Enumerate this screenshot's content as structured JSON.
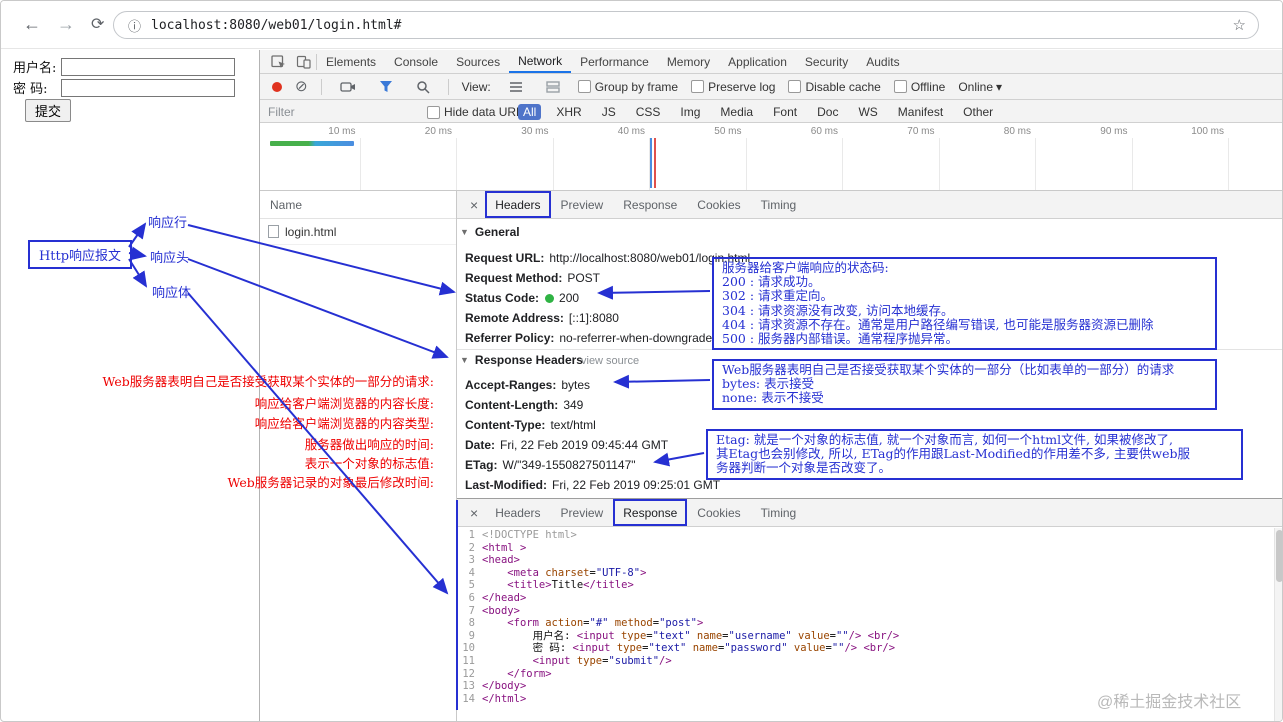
{
  "browser": {
    "url": "localhost:8080/web01/login.html#"
  },
  "icons": {
    "back": "←",
    "forward": "→",
    "refresh": "⟳",
    "info": "ⓘ",
    "star": "☆",
    "close": "×",
    "caret_down": "▾",
    "triangle_down": "▼",
    "record": "●",
    "clear": "⊘"
  },
  "login_form": {
    "username_label": "用户名:",
    "username_value": "",
    "password_label": "密 码:",
    "password_value": "",
    "submit_label": "提交"
  },
  "devtools": {
    "tabs": [
      "Elements",
      "Console",
      "Sources",
      "Network",
      "Performance",
      "Memory",
      "Application",
      "Security",
      "Audits"
    ],
    "selected_tab": "Network",
    "toolbar": {
      "view_label": "View:",
      "checkboxes": [
        "Group by frame",
        "Preserve log",
        "Disable cache",
        "Offline"
      ],
      "online_label": "Online"
    },
    "filter_bar": {
      "placeholder": "Filter",
      "hide_data_urls": "Hide data URLs",
      "types": [
        "All",
        "XHR",
        "JS",
        "CSS",
        "Img",
        "Media",
        "Font",
        "Doc",
        "WS",
        "Manifest",
        "Other"
      ],
      "selected_type": "All"
    },
    "timeline": {
      "ticks": [
        "10 ms",
        "20 ms",
        "30 ms",
        "40 ms",
        "50 ms",
        "60 ms",
        "70 ms",
        "80 ms",
        "90 ms",
        "100 ms"
      ]
    },
    "request_list": {
      "name_header": "Name",
      "rows": [
        "login.html"
      ]
    },
    "panel1": {
      "tabs": [
        "Headers",
        "Preview",
        "Response",
        "Cookies",
        "Timing"
      ],
      "selected": "Headers",
      "general": {
        "title": "General",
        "fields": [
          {
            "name": "Request URL:",
            "value": "http://localhost:8080/web01/login.html"
          },
          {
            "name": "Request Method:",
            "value": "POST"
          },
          {
            "name": "Status Code:",
            "value": "200",
            "status_dot": true
          },
          {
            "name": "Remote Address:",
            "value": "[::1]:8080"
          },
          {
            "name": "Referrer Policy:",
            "value": "no-referrer-when-downgrade"
          }
        ]
      },
      "response_headers": {
        "title": "Response Headers",
        "view_source_label": "view source",
        "fields": [
          {
            "name": "Accept-Ranges:",
            "value": "bytes"
          },
          {
            "name": "Content-Length:",
            "value": "349"
          },
          {
            "name": "Content-Type:",
            "value": "text/html"
          },
          {
            "name": "Date:",
            "value": "Fri, 22 Feb 2019 09:45:44 GMT"
          },
          {
            "name": "ETag:",
            "value": "W/\"349-1550827501147\""
          },
          {
            "name": "Last-Modified:",
            "value": "Fri, 22 Feb 2019 09:25:01 GMT"
          }
        ]
      }
    },
    "panel2": {
      "tabs": [
        "Headers",
        "Preview",
        "Response",
        "Cookies",
        "Timing"
      ],
      "selected": "Response",
      "code_lines": [
        "<!DOCTYPE html>",
        "<html >",
        "<head>",
        "    <meta charset=\"UTF-8\">",
        "    <title>Title</title>",
        "</head>",
        "<body>",
        "    <form action=\"#\" method=\"post\">",
        "        用户名: <input type=\"text\" name=\"username\" value=\"\"/> <br/>",
        "        密 码: <input type=\"text\" name=\"password\" value=\"\"/> <br/>",
        "        <input type=\"submit\"/>",
        "    </form>",
        "</body>",
        "</html>"
      ]
    }
  },
  "annotations": {
    "accent_color": "#2630d2",
    "http_box_label": "Http响应报文",
    "pointer_labels": [
      "响应行",
      "响应头",
      "响应体"
    ],
    "panel1_ringed_tab": "Headers",
    "panel2_ringed_tab": "Response",
    "red_notes": [
      "Web服务器表明自己是否接受获取某个实体的一部分的请求:",
      "响应给客户端浏览器的内容长度:",
      "响应给客户端浏览器的内容类型:",
      "服务器做出响应的时间:",
      "表示一个对象的标志值:",
      "Web服务器记录的对象最后修改时间:"
    ],
    "status_code_box_lines": [
      "服务器给客户端响应的状态码:",
      "200 : 请求成功。",
      "302 : 请求重定向。",
      "304 : 请求资源没有改变, 访问本地缓存。",
      "404 : 请求资源不存在。通常是用户路径编写错误, 也可能是服务器资源已删除",
      "500 : 服务器内部错误。通常程序抛异常。"
    ],
    "accept_ranges_box_lines": [
      "Web服务器表明自己是否接受获取某个实体的一部分（比如表单的一部分）的请求",
      "bytes: 表示接受",
      "none: 表示不接受"
    ],
    "etag_box_lines": [
      "Etag: 就是一个对象的标志值, 就一个对象而言, 如何一个html文件, 如果被修改了,",
      "其Etag也会别修改, 所以, ETag的作用跟Last-Modified的作用差不多, 主要供web服",
      "务器判断一个对象是否改变了。"
    ]
  },
  "watermark": "@稀土掘金技术社区"
}
